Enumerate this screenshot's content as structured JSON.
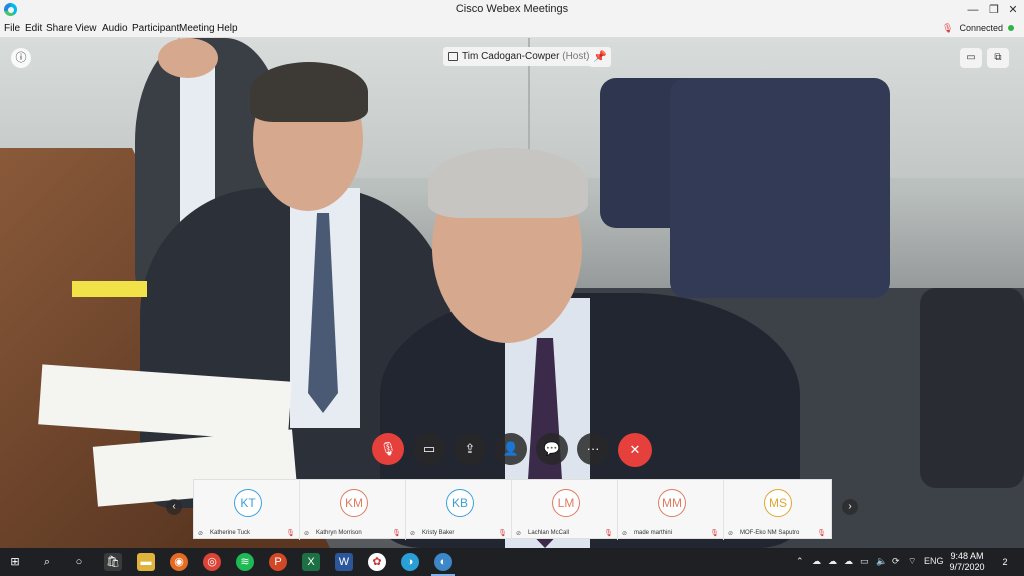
{
  "window": {
    "title": "Cisco Webex Meetings",
    "minimize": "—",
    "restore": "❐",
    "close": "✕"
  },
  "menu": [
    "File",
    "Edit",
    "Share",
    "View",
    "Audio",
    "Participant",
    "Meeting",
    "Help"
  ],
  "status": {
    "connected": "Connected",
    "mic_icon": "🎙",
    "color_ok": "#2fb344"
  },
  "stage": {
    "host_name": "Tim Cadogan-Cowper",
    "host_suffix": "(Host)",
    "info_icon": "ⓘ",
    "pin_icon": "📌",
    "view_icon": "▭",
    "popout_icon": "⧉"
  },
  "controls": {
    "mute": "🎙",
    "video": "▭",
    "share": "⇪",
    "participants": "👤",
    "chat": "💬",
    "more": "···",
    "leave": "✕",
    "leave_color": "#e5403b"
  },
  "participants": [
    {
      "initials": "KT",
      "name": "Katherine Tuck",
      "color": "#3aa0d8"
    },
    {
      "initials": "KM",
      "name": "Kathryn Morrison",
      "color": "#e07a5f"
    },
    {
      "initials": "KB",
      "name": "Kristy Baker",
      "color": "#3aa0d8"
    },
    {
      "initials": "LM",
      "name": "Lachlan McCall",
      "color": "#e07a5f"
    },
    {
      "initials": "MM",
      "name": "made marthini",
      "color": "#e07a5f"
    },
    {
      "initials": "MS",
      "name": "MOF-Eko NM Saputro",
      "color": "#e0a530"
    }
  ],
  "strip_nav": {
    "prev": "‹",
    "next": "›"
  },
  "taskbar": {
    "time": "9:48 AM",
    "date": "9/7/2020",
    "lang": "ENG",
    "notifications": "2"
  }
}
